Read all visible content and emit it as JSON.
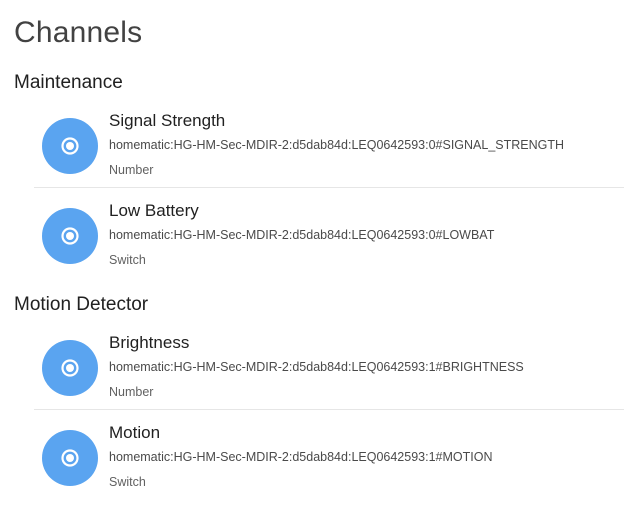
{
  "page": {
    "title": "Channels"
  },
  "groups": [
    {
      "title": "Maintenance",
      "channels": [
        {
          "label": "Signal Strength",
          "uid": "homematic:HG-HM-Sec-MDIR-2:d5dab84d:LEQ0642593:0#SIGNAL_STRENGTH",
          "type": "Number",
          "icon": "radio-button-icon"
        },
        {
          "label": "Low Battery",
          "uid": "homematic:HG-HM-Sec-MDIR-2:d5dab84d:LEQ0642593:0#LOWBAT",
          "type": "Switch",
          "icon": "radio-button-icon"
        }
      ]
    },
    {
      "title": "Motion Detector",
      "channels": [
        {
          "label": "Brightness",
          "uid": "homematic:HG-HM-Sec-MDIR-2:d5dab84d:LEQ0642593:1#BRIGHTNESS",
          "type": "Number",
          "icon": "radio-button-icon"
        },
        {
          "label": "Motion",
          "uid": "homematic:HG-HM-Sec-MDIR-2:d5dab84d:LEQ0642593:1#MOTION",
          "type": "Switch",
          "icon": "radio-button-icon"
        }
      ]
    }
  ],
  "colors": {
    "icon_background": "#5aa4f0",
    "icon_foreground": "#ffffff",
    "divider": "#e6e6e6"
  }
}
